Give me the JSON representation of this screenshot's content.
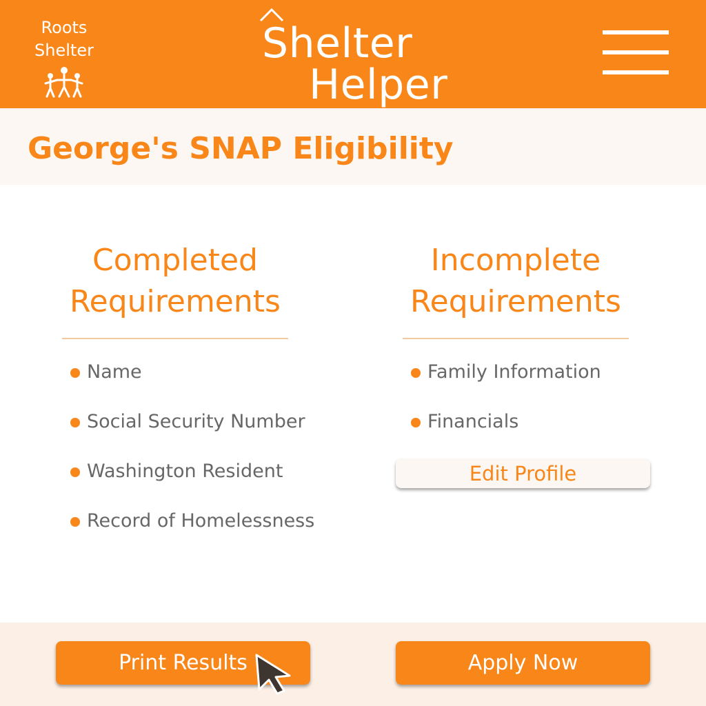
{
  "header": {
    "brand_line1": "Roots",
    "brand_line2": "Shelter",
    "brand_icon": "family-icon",
    "app_title_line1": "Shelter",
    "app_title_line2": "Helper",
    "title_icon": "roof-icon",
    "menu_icon": "hamburger-menu-icon"
  },
  "page": {
    "title": "George's SNAP Eligibility"
  },
  "completed": {
    "heading_line1": "Completed",
    "heading_line2": "Requirements",
    "items": [
      "Name",
      "Social Security Number",
      "Washington Resident",
      "Record of Homelessness"
    ]
  },
  "incomplete": {
    "heading_line1": "Incomplete",
    "heading_line2": "Requirements",
    "items": [
      "Family Information",
      "Financials"
    ],
    "edit_label": "Edit Profile"
  },
  "actions": {
    "print_label": "Print Results",
    "apply_label": "Apply Now"
  },
  "colors": {
    "accent": "#F98618",
    "light_band": "#FCF7F3",
    "action_band": "#FCF0E6",
    "body_text": "#676767"
  }
}
